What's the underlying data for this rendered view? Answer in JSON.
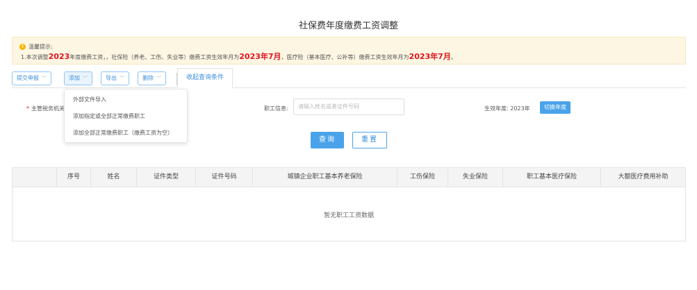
{
  "page": {
    "title": "社保费年度缴费工资调整"
  },
  "notice": {
    "icon": "warning-icon",
    "title": "温馨提示:",
    "line": {
      "p1": "1.本次调整",
      "year1": "2023",
      "p2": "年度缴费工资，，社保险（养老、工伤、失业等）缴费工资生效年月为",
      "month1": "2023年7月",
      "p3": "，医疗险（基本医疗、公补等）缴费工资生效年月为",
      "month2": "2023年7月",
      "p4": "。"
    },
    "highlight_color": "#e0141e"
  },
  "toolbar": {
    "submit": "提交申报",
    "add": "添加",
    "export": "导出",
    "delete": "删除",
    "collapse_tab": "收起查询条件"
  },
  "add_menu": {
    "items": [
      "外部文件导入",
      "添加指定或全部正常缴费职工",
      "添加全部正常缴费职工（缴费工资为空）"
    ]
  },
  "form": {
    "tax_office_label": "主管税务机关",
    "employee_label": "职工信息:",
    "employee_placeholder": "请输入姓名或者证件号码",
    "effective_year_label": "生效年度: 2023年",
    "switch_year": "切换年度",
    "query": "查询",
    "reset": "重置"
  },
  "table": {
    "columns": [
      "序号",
      "姓名",
      "证件类型",
      "证件号码",
      "城镇企业职工基本养老保险",
      "工伤保险",
      "失业保险",
      "职工基本医疗保险",
      "大额医疗费用补助"
    ],
    "rows": [],
    "empty_text": "暂无职工工资数据"
  },
  "colors": {
    "accent": "#4aa3ea",
    "warning_bg": "#fdf6e3"
  }
}
